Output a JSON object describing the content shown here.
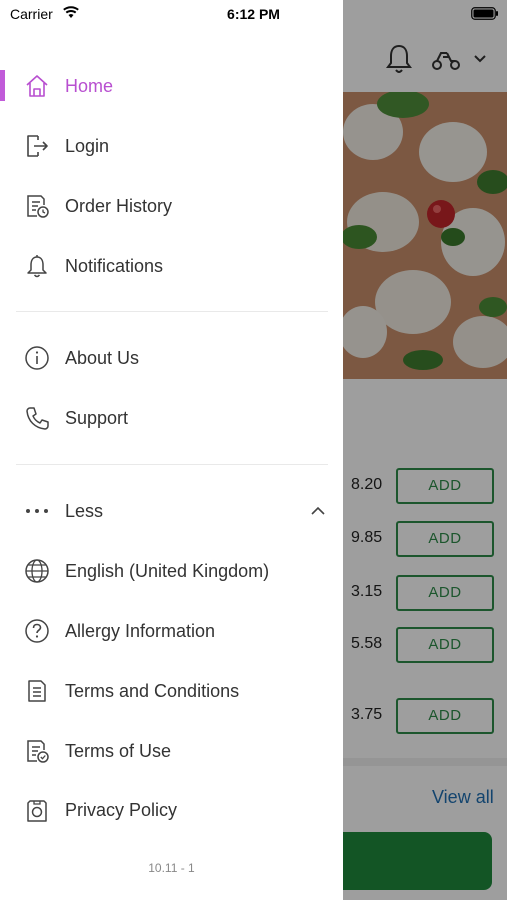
{
  "status_bar": {
    "carrier": "Carrier",
    "time": "6:12 PM"
  },
  "drawer": {
    "accent_color": "#b84fd0",
    "primary": [
      {
        "label": "Home",
        "icon": "home-icon",
        "active": true
      },
      {
        "label": "Login",
        "icon": "login-icon"
      },
      {
        "label": "Order History",
        "icon": "order-history-icon"
      },
      {
        "label": "Notifications",
        "icon": "bell-icon"
      }
    ],
    "secondary": [
      {
        "label": "About Us",
        "icon": "info-icon"
      },
      {
        "label": "Support",
        "icon": "phone-icon"
      }
    ],
    "more_toggle": {
      "label": "Less",
      "icon": "more-dots-icon"
    },
    "extra": [
      {
        "label": "English (United Kingdom)",
        "icon": "globe-icon"
      },
      {
        "label": "Allergy Information",
        "icon": "question-icon"
      },
      {
        "label": "Terms and Conditions",
        "icon": "document-icon"
      },
      {
        "label": "Terms of Use",
        "icon": "document-check-icon"
      },
      {
        "label": "Privacy Policy",
        "icon": "privacy-icon"
      }
    ],
    "version": "10.11 - 1"
  },
  "background": {
    "prices": [
      "8.20",
      "9.85",
      "3.15",
      "5.58",
      "3.75"
    ],
    "add_label": "ADD",
    "view_all": "View all",
    "add_color": "#2e8b4a",
    "cta_color": "#1f8a3c"
  }
}
